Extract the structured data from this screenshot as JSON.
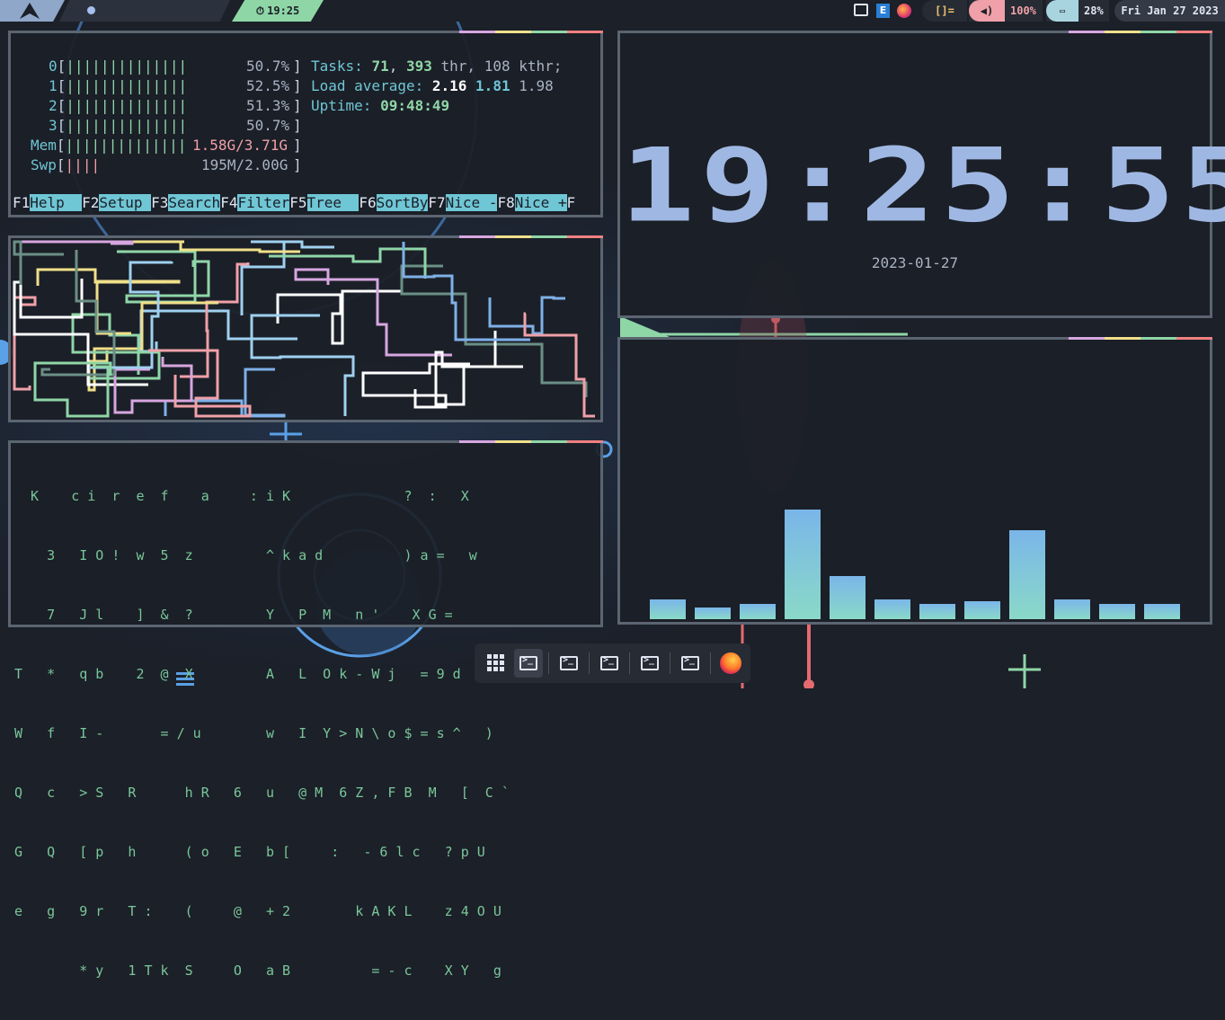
{
  "topbar": {
    "time": "19:25",
    "layout_symbol": "[]=",
    "volume": "100%",
    "battery": "28%",
    "date": "Fri Jan 27 2023",
    "clock_icon": "clock-icon",
    "volume_icon": "speaker-icon",
    "battery_icon": "battery-icon"
  },
  "htop": {
    "cpus": [
      {
        "id": "0",
        "bars": "||||||||||||||",
        "percent": "50.7%"
      },
      {
        "id": "1",
        "bars": "||||||||||||||",
        "percent": "52.5%"
      },
      {
        "id": "2",
        "bars": "||||||||||||||",
        "percent": "51.3%"
      },
      {
        "id": "3",
        "bars": "||||||||||||||",
        "percent": "50.7%"
      }
    ],
    "mem": {
      "label": "Mem",
      "bars": "||||||||||||||",
      "value": "1.58G/3.71G"
    },
    "swp": {
      "label": "Swp",
      "bars": "||||",
      "value": "195M/2.00G"
    },
    "tasks_label": "Tasks:",
    "tasks": "71",
    "threads": "393",
    "thr_label": "thr,",
    "kthr": "108",
    "kthr_label": "kthr;",
    "load_label": "Load average:",
    "load1": "2.16",
    "load5": "1.81",
    "load15": "1.98",
    "uptime_label": "Uptime:",
    "uptime": "09:48:49",
    "fkeys": [
      {
        "key": "F1",
        "label": "Help  "
      },
      {
        "key": "F2",
        "label": "Setup "
      },
      {
        "key": "F3",
        "label": "Search"
      },
      {
        "key": "F4",
        "label": "Filter"
      },
      {
        "key": "F5",
        "label": "Tree  "
      },
      {
        "key": "F6",
        "label": "SortBy"
      },
      {
        "key": "F7",
        "label": "Nice -"
      },
      {
        "key": "F8",
        "label": "Nice +"
      },
      {
        "key": "F",
        "label": ""
      }
    ]
  },
  "clock_widget": {
    "time": "19:25:55",
    "date": "2023-01-27"
  },
  "matrix": {
    "rows": [
      "  K    c i  r  e  f    a     : i K              ?  :   X",
      "    3   I O !  w  5  z         ^ k a d          ) a =   w",
      "    7   J l    ]  &  ?         Y   P  M   n '    X G =",
      "T   *   q b    2  @  X         A   L  O k - W j   = 9 d",
      "W   f   I -       = / u        w   I  Y > N \\ o $ = s ^   )",
      "Q   c   > S   R      h R   6   u   @ M  6 Z , F B  M   [  C `",
      "G   Q   [ p   h      ( o   E   b [     :   - 6 l c   ? p U",
      "e   g   9 r   T :    (     @   + 2        k A K L    z 4 O U",
      "        * y   1 T k  S     O   a B          = - c    X Y   g"
    ]
  },
  "cava": {
    "levels": [
      0.18,
      0.11,
      0.14,
      1.0,
      0.39,
      0.18,
      0.14,
      0.16,
      0.81,
      0.18,
      0.14,
      0.14
    ]
  },
  "colors": {
    "accent_blue": "#9fb8e3",
    "accent_green": "#8fd6a7",
    "accent_pink": "#f0a0a8",
    "accent_cyan": "#6fc6d5",
    "panel_border": "#5b6571"
  },
  "dock": {
    "items": [
      "apps-grid-icon",
      "terminal-icon",
      "terminal-icon",
      "terminal-icon",
      "terminal-icon",
      "terminal-icon",
      "firefox-icon"
    ]
  }
}
